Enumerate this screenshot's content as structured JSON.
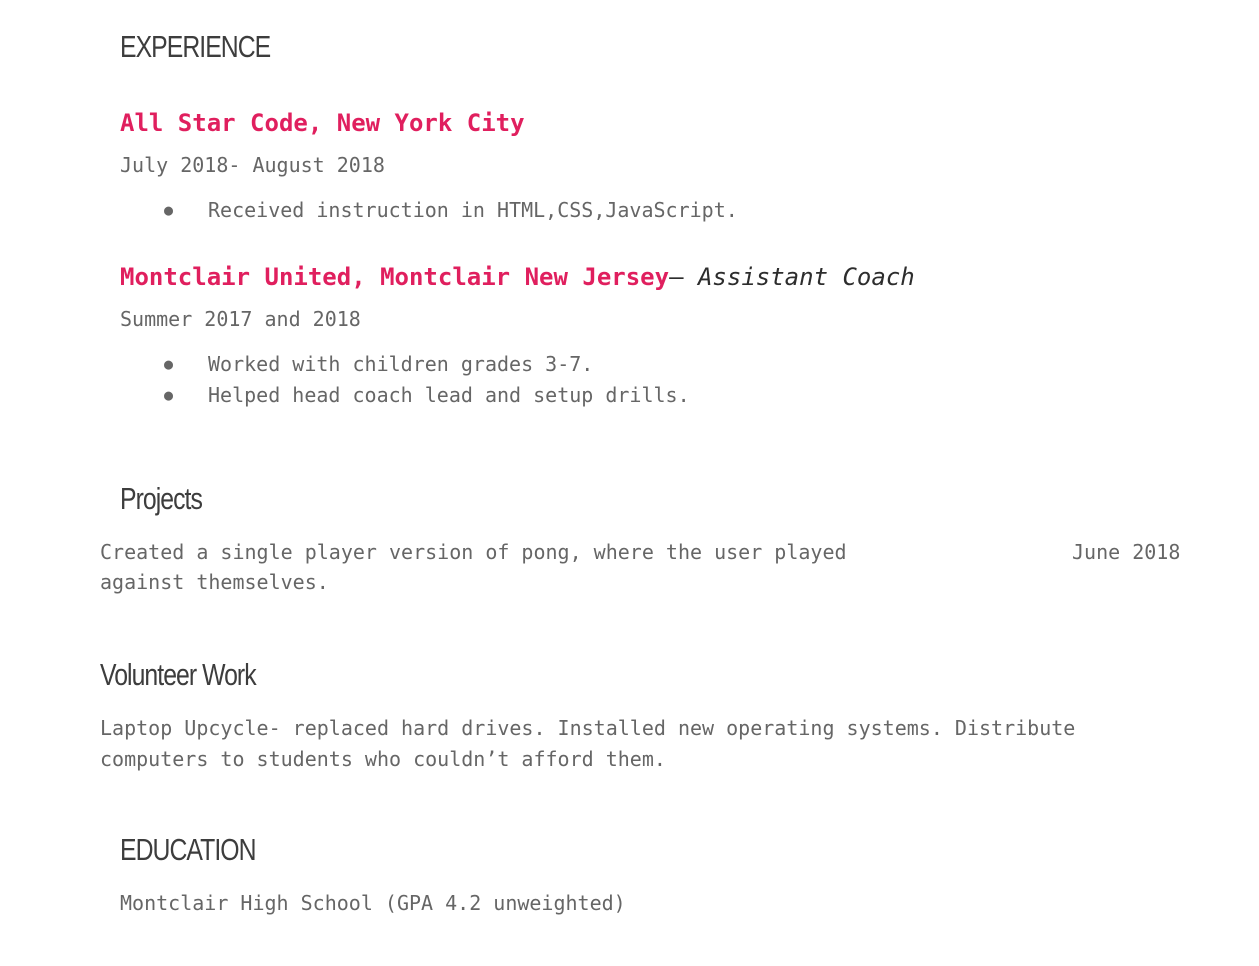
{
  "experience": {
    "heading": "EXPERIENCE",
    "jobs": [
      {
        "org": "All Star Code, New York City",
        "dates": "July 2018- August 2018",
        "bullets": [
          "Received instruction in HTML,CSS,JavaScript."
        ]
      },
      {
        "org": "Montclair United, Montclair New Jersey",
        "separator": "— ",
        "role": "Assistant Coach",
        "dates": "Summer 2017 and 2018",
        "bullets": [
          "Worked with children grades 3-7.",
          "Helped head coach lead and setup drills."
        ]
      }
    ]
  },
  "projects": {
    "heading": "Projects",
    "line1": "Created a single player version of pong, where the user played",
    "line2": "against themselves.",
    "date": "June 2018"
  },
  "volunteer": {
    "heading": "Volunteer Work",
    "line1": "Laptop Upcycle- replaced hard drives. Installed new operating systems. Distribute",
    "line2": "computers to students who couldn’t afford them."
  },
  "education": {
    "heading": "EDUCATION",
    "school": "Montclair High School (GPA 4.2 unweighted)"
  }
}
